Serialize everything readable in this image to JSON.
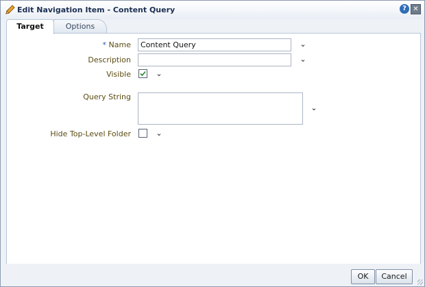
{
  "dialog": {
    "title": "Edit Navigation Item - Content Query",
    "help_symbol": "?",
    "close_symbol": "✕"
  },
  "tabs": [
    {
      "label": "Target",
      "active": true
    },
    {
      "label": "Options",
      "active": false
    }
  ],
  "form": {
    "required_marker": "*",
    "name": {
      "label": "Name",
      "value": "Content Query"
    },
    "description": {
      "label": "Description",
      "value": ""
    },
    "visible": {
      "label": "Visible",
      "checked": true
    },
    "query_string": {
      "label": "Query String",
      "value": ""
    },
    "hide_top_level_folder": {
      "label": "Hide Top-Level Folder",
      "checked": false
    },
    "chevron_symbol": "⌄"
  },
  "buttons": {
    "ok": "OK",
    "cancel": "Cancel"
  },
  "colors": {
    "accent": "#2f6db8",
    "label": "#5a4a10",
    "title": "#1c2f52"
  }
}
